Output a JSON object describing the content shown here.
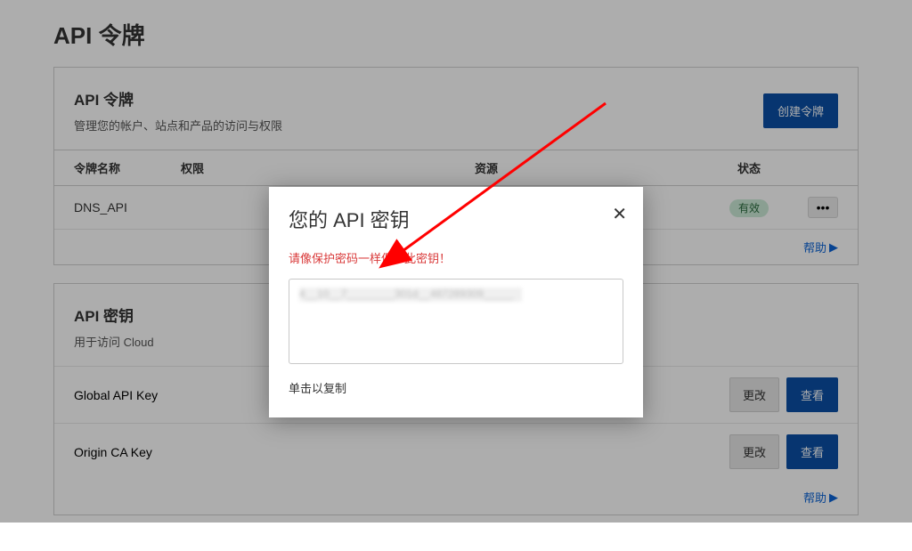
{
  "page": {
    "title": "API 令牌"
  },
  "tokens_card": {
    "title": "API 令牌",
    "subtitle": "管理您的帐户、站点和产品的访问与权限",
    "create_button": "创建令牌",
    "columns": {
      "name": "令牌名称",
      "perm": "权限",
      "resource": "资源",
      "status": "状态"
    },
    "rows": [
      {
        "name": "DNS_API",
        "perm": "",
        "resource": "",
        "status": "有效"
      }
    ],
    "help": "帮助"
  },
  "keys_card": {
    "title": "API 密钥",
    "subtitle": "用于访问 Cloud",
    "rows": [
      {
        "name": "Global API Key"
      },
      {
        "name": "Origin CA Key"
      }
    ],
    "change_button": "更改",
    "view_button": "查看",
    "help": "帮助"
  },
  "modal": {
    "title": "您的 API 密钥",
    "warning": "请像保护密码一样保护此密钥！",
    "key_masked": "4__10__7________301d__487289309_____",
    "copy_hint": "单击以复制"
  }
}
